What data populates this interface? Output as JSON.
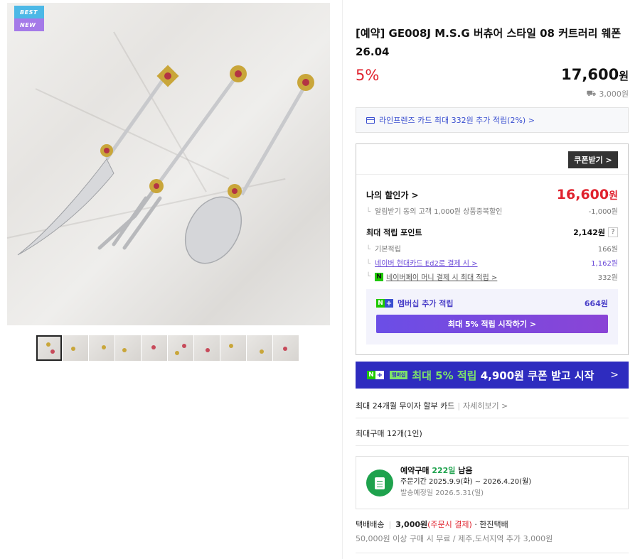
{
  "badges": {
    "best": "BEST",
    "new": "NEW"
  },
  "product": {
    "title": "[예약] GE008J M.S.G 버츄어 스타일 08 커트러리 웨폰 26.04",
    "discount": "5%",
    "price": "17,600",
    "price_unit": "원",
    "shipping_fee": "3,000원"
  },
  "card_banner": "라인프렌즈 카드 최대 332원 추가 적립(2%) >",
  "coupon_button": "쿠폰받기 >",
  "benefits": {
    "my_price_label": "나의 할인가 >",
    "my_price": "16,600",
    "my_price_unit": "원",
    "alarm_label": "알림받기 동의 고객 1,000원 상품중복할인",
    "alarm_value": "-1,000원",
    "max_points_label": "최대 적립 포인트",
    "max_points_value": "2,142원",
    "help": "?",
    "basic_label": "기본적립",
    "basic_value": "166원",
    "naver_card_label": "네이버 현대카드 Ed2로 결제 시 >",
    "naver_card_value": "1,162원",
    "npay_label": "네이버페이 머니 결제 시 최대 적립 >",
    "npay_value": "332원",
    "npay_n": "N",
    "membership_label": "멤버십 추가 적립",
    "membership_value": "664원",
    "membership_cta": "최대 5% 적립 시작하기 >"
  },
  "big_banner": {
    "prefix": "최대 5% 적립",
    "suffix": "4,900원 쿠폰 받고 시작",
    "tag": "멤버십",
    "n": "N",
    "plus": "+",
    "chevron": ">"
  },
  "installment": {
    "label": "최대 24개월 무이자 할부 카드",
    "link": "자세히보기 >"
  },
  "max_purchase": "최대구매 12개(1인)",
  "preorder": {
    "title_prefix": "예약구매",
    "days": "222일",
    "title_suffix": "남음",
    "order_period_label": "주문기간",
    "order_period": "2025.9.9(화) ~ 2026.4.20(월)",
    "ship_date_label": "발송예정일",
    "ship_date": "2026.5.31(일)"
  },
  "delivery": {
    "type": "택배배송",
    "fee": "3,000원",
    "pay": "(주문시 결제)",
    "carrier": "· 한진택배",
    "note": "50,000원 이상 구매 시 무료 / 제주,도서지역 추가 3,000원"
  },
  "colors": {
    "accent_red": "#e0222e",
    "brand_blue": "#2e2cbf",
    "naver_green": "#1ec800",
    "purple": "#6b4ee6"
  }
}
